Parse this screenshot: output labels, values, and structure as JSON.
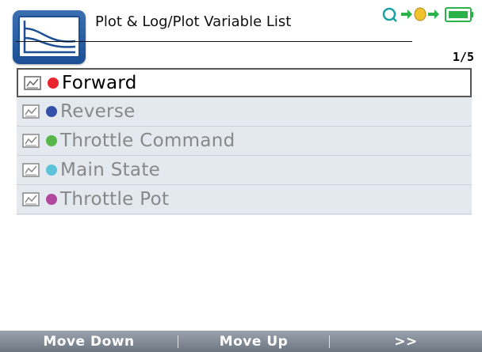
{
  "header": {
    "title": "Plot & Log/Plot Variable List",
    "page_indicator": "1/5",
    "app_icon": "plot-chart-icon",
    "status_icons": [
      "search-icon",
      "connection-icon",
      "battery-icon"
    ]
  },
  "variables": [
    {
      "label": "Forward",
      "color": "#e8262b",
      "icon": "plot-doc-icon",
      "selected": true
    },
    {
      "label": "Reverse",
      "color": "#3550a8",
      "icon": "plot-doc-icon",
      "selected": false
    },
    {
      "label": "Throttle Command",
      "color": "#58b64b",
      "icon": "plot-doc-icon",
      "selected": false
    },
    {
      "label": "Main State",
      "color": "#5cc3d8",
      "icon": "plot-doc-icon",
      "selected": false
    },
    {
      "label": "Throttle Pot",
      "color": "#b2479f",
      "icon": "plot-doc-icon",
      "selected": false
    }
  ],
  "softkeys": {
    "move_down": "Move Down",
    "move_up": "Move Up",
    "more": ">>"
  }
}
